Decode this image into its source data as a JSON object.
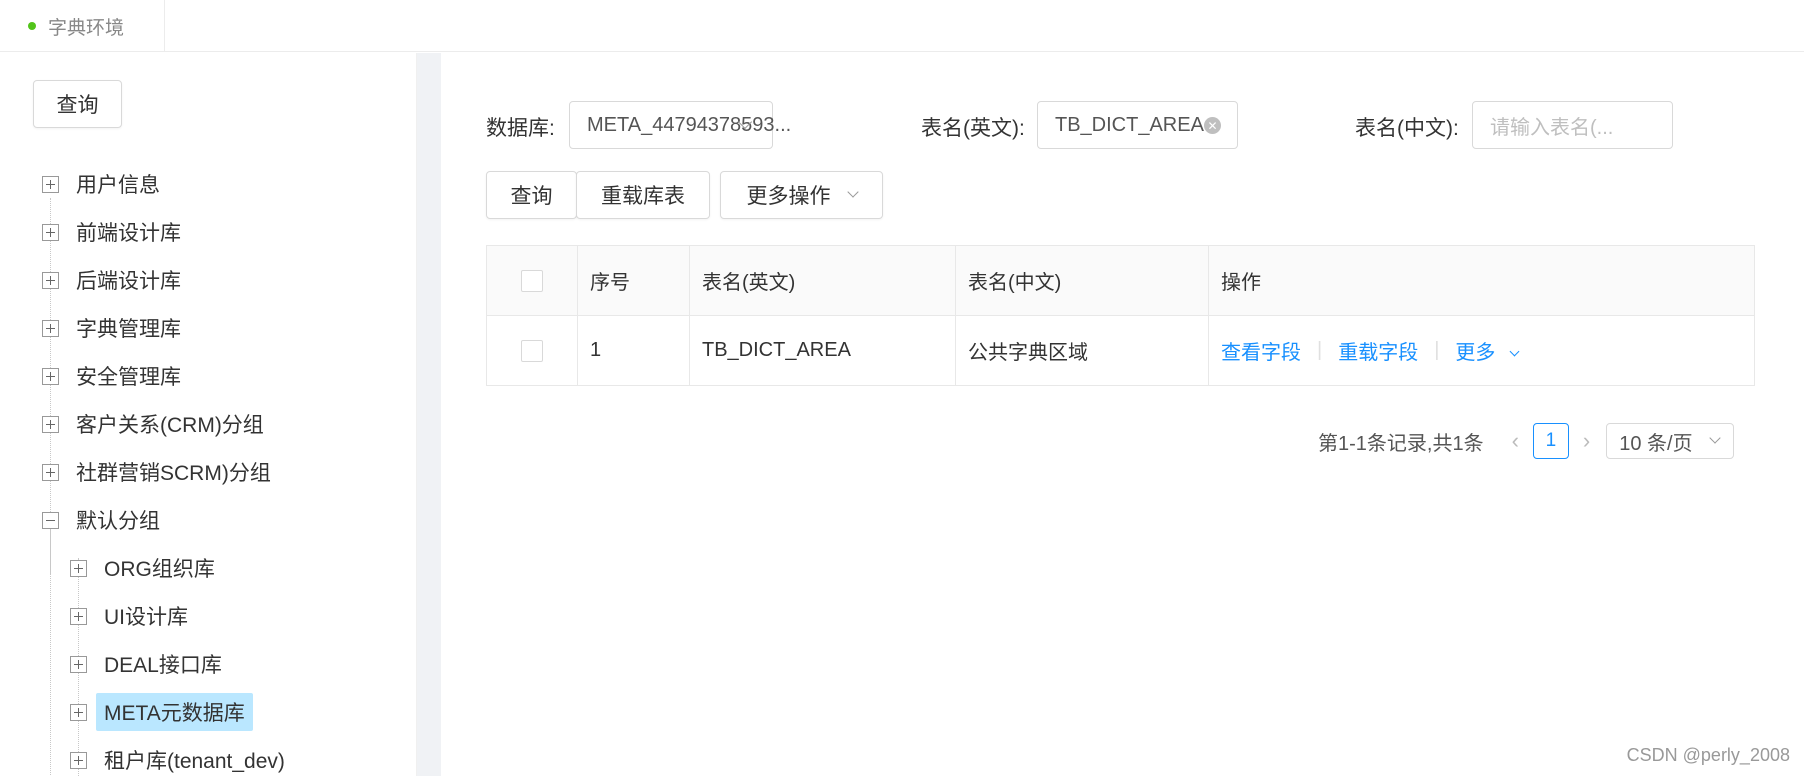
{
  "tab": {
    "label": "字典环境",
    "dot_color": "#52c41a"
  },
  "sidebar": {
    "query_button": "查询",
    "nodes": [
      {
        "label": "用户信息",
        "expanded": false
      },
      {
        "label": "前端设计库",
        "expanded": false
      },
      {
        "label": "后端设计库",
        "expanded": false
      },
      {
        "label": "字典管理库",
        "expanded": false
      },
      {
        "label": "安全管理库",
        "expanded": false
      },
      {
        "label": "客户关系(CRM)分组",
        "expanded": false
      },
      {
        "label": "社群营销SCRM)分组",
        "expanded": false
      },
      {
        "label": "默认分组",
        "expanded": true
      }
    ],
    "children": [
      {
        "label": "ORG组织库",
        "selected": false
      },
      {
        "label": "UI设计库",
        "selected": false
      },
      {
        "label": "DEAL接口库",
        "selected": false
      },
      {
        "label": "META元数据库",
        "selected": true
      },
      {
        "label": "租户库(tenant_dev)",
        "selected": false
      }
    ]
  },
  "filters": {
    "db_label": "数据库:",
    "db_value": "META_44794378593...",
    "table_en_label": "表名(英文):",
    "table_en_value": "TB_DICT_AREA",
    "table_cn_label": "表名(中文):",
    "table_cn_placeholder": "请输入表名(..."
  },
  "toolbar": {
    "query": "查询",
    "reload_tables": "重载库表",
    "more_actions": "更多操作"
  },
  "table": {
    "columns": [
      "序号",
      "表名(英文)",
      "表名(中文)",
      "操作"
    ],
    "rows": [
      {
        "index": "1",
        "name_en": "TB_DICT_AREA",
        "name_cn": "公共字典区域",
        "actions": [
          "查看字段",
          "重载字段",
          "更多"
        ]
      }
    ]
  },
  "pagination": {
    "summary": "第1-1条记录,共1条",
    "current_page": "1",
    "page_size": "10 条/页"
  },
  "watermark": "CSDN @perly_2008",
  "colors": {
    "accent": "#1890ff",
    "selected_bg": "#bae7ff"
  }
}
